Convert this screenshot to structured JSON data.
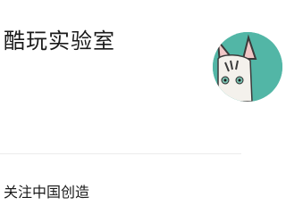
{
  "profile": {
    "name": "酷玩实验室",
    "avatar_icon": "cat-avatar-icon",
    "avatar_bg": "#52b6a6"
  },
  "section": {
    "label": "关注中国创造"
  }
}
